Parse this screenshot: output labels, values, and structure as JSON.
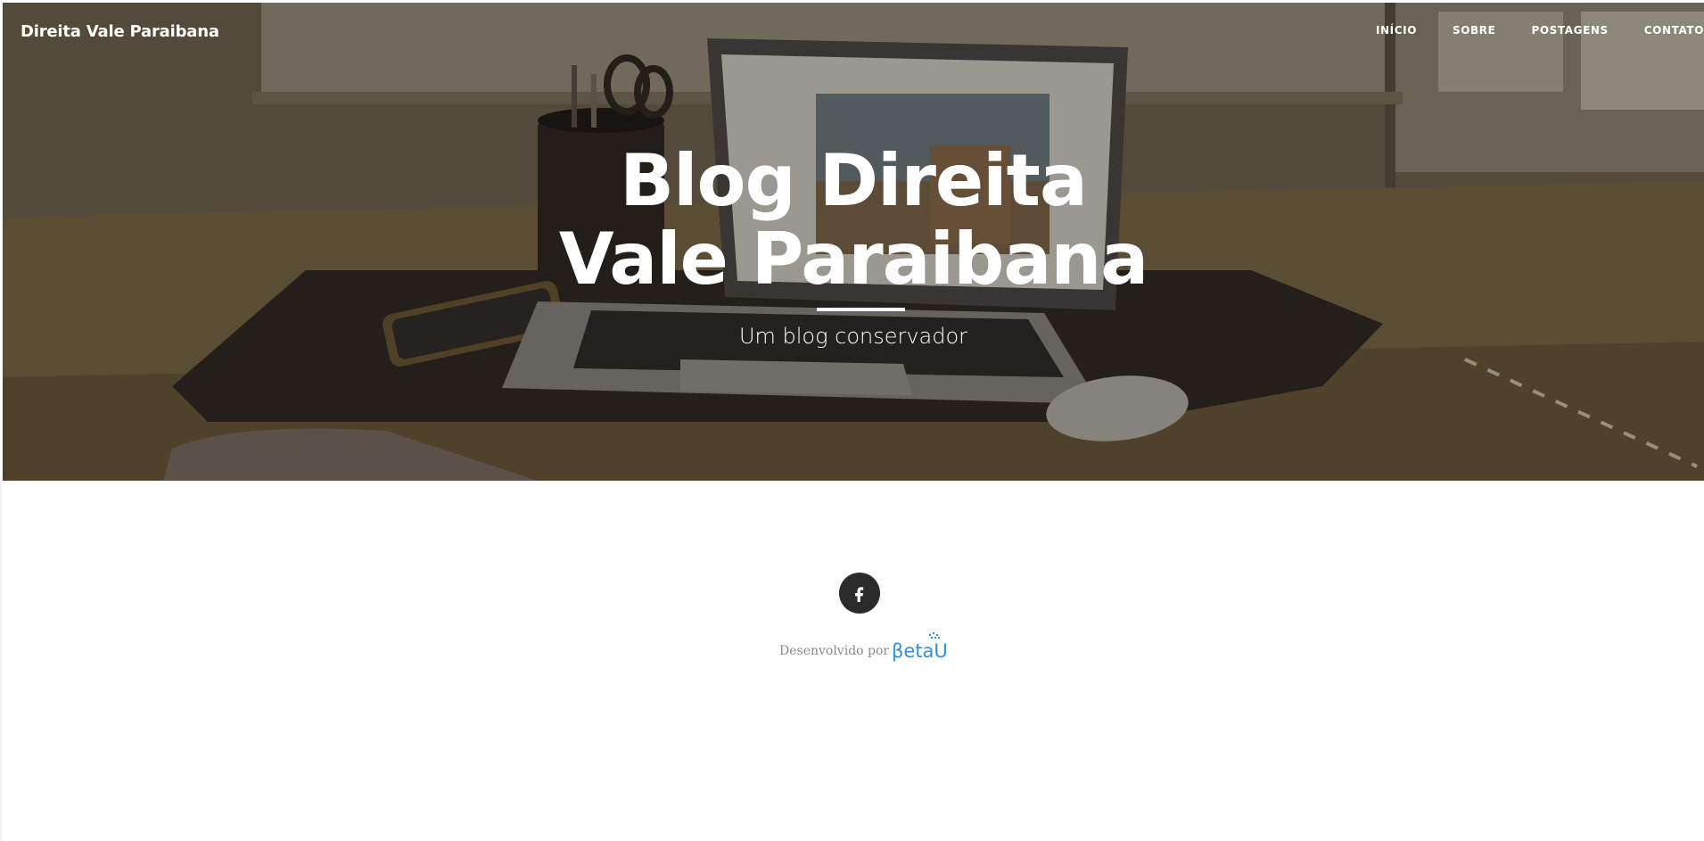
{
  "brand": {
    "name": "Direita Vale Paraibana"
  },
  "nav": {
    "items": [
      {
        "label": "INÍCIO"
      },
      {
        "label": "SOBRE"
      },
      {
        "label": "POSTAGENS"
      },
      {
        "label": "CONTATO"
      }
    ]
  },
  "hero": {
    "title": "Blog Direita Vale Paraibana",
    "subtitle": "Um blog conservador"
  },
  "footer": {
    "social": [
      {
        "icon": "facebook-icon"
      }
    ],
    "credit_text": "Desenvolvido por",
    "credit_logo_text": "βetaUp",
    "credit_logo_color": "#2f8fe0"
  },
  "colors": {
    "hero_text": "#ffffff",
    "social_bg": "#2b2b2b"
  }
}
